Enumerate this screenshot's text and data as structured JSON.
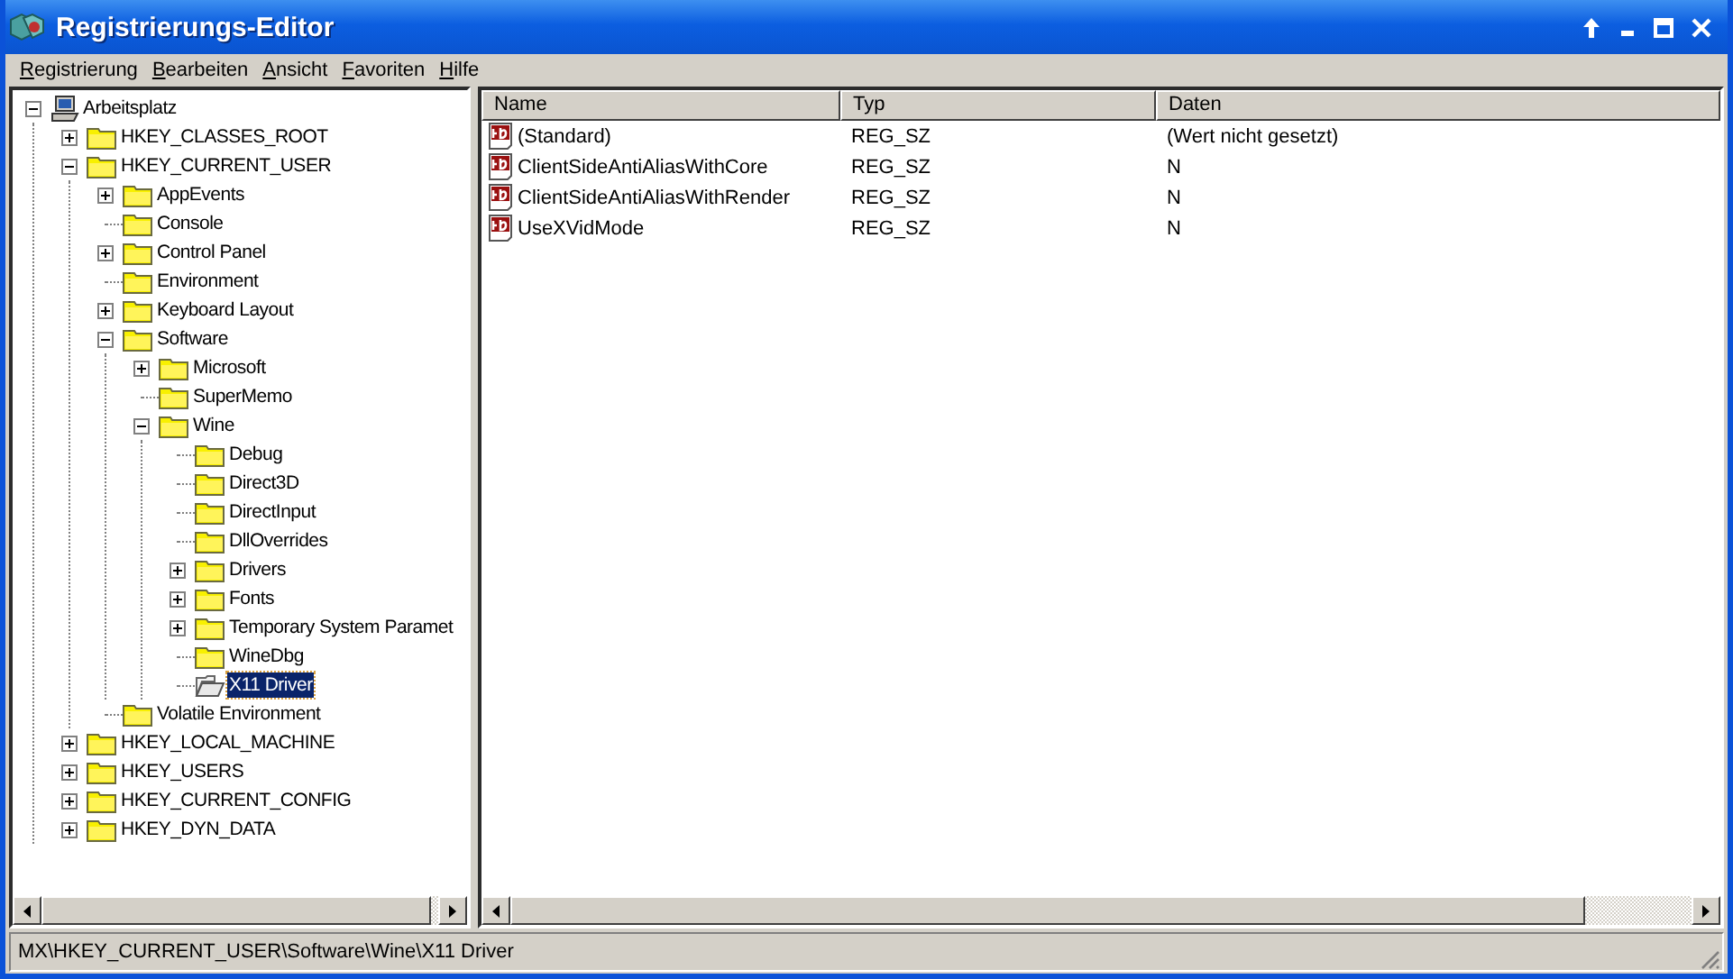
{
  "window": {
    "title": "Registrierungs-Editor"
  },
  "menu": [
    "Registrierung",
    "Bearbeiten",
    "Ansicht",
    "Favoriten",
    "Hilfe"
  ],
  "tree": {
    "label": "Arbeitsplatz",
    "expanded": true,
    "selected": false,
    "children": [
      {
        "label": "HKEY_CLASSES_ROOT",
        "expanded": false,
        "selected": false
      },
      {
        "label": "HKEY_CURRENT_USER",
        "expanded": true,
        "selected": false,
        "children": [
          {
            "label": "AppEvents",
            "expanded": false,
            "selected": false
          },
          {
            "label": "Console",
            "selected": false
          },
          {
            "label": "Control Panel",
            "expanded": false,
            "selected": false
          },
          {
            "label": "Environment",
            "selected": false
          },
          {
            "label": "Keyboard Layout",
            "expanded": false,
            "selected": false
          },
          {
            "label": "Software",
            "expanded": true,
            "selected": false,
            "children": [
              {
                "label": "Microsoft",
                "expanded": false,
                "selected": false
              },
              {
                "label": "SuperMemo",
                "selected": false
              },
              {
                "label": "Wine",
                "expanded": true,
                "selected": false,
                "children": [
                  {
                    "label": "Debug",
                    "selected": false
                  },
                  {
                    "label": "Direct3D",
                    "selected": false
                  },
                  {
                    "label": "DirectInput",
                    "selected": false
                  },
                  {
                    "label": "DllOverrides",
                    "selected": false
                  },
                  {
                    "label": "Drivers",
                    "expanded": false,
                    "selected": false
                  },
                  {
                    "label": "Fonts",
                    "expanded": false,
                    "selected": false
                  },
                  {
                    "label": "Temporary System Paramet",
                    "expanded": false,
                    "selected": false
                  },
                  {
                    "label": "WineDbg",
                    "selected": false
                  },
                  {
                    "label": "X11 Driver",
                    "selected": true
                  }
                ]
              }
            ]
          },
          {
            "label": "Volatile Environment",
            "selected": false
          }
        ]
      },
      {
        "label": "HKEY_LOCAL_MACHINE",
        "expanded": false,
        "selected": false
      },
      {
        "label": "HKEY_USERS",
        "expanded": false,
        "selected": false
      },
      {
        "label": "HKEY_CURRENT_CONFIG",
        "expanded": false,
        "selected": false
      },
      {
        "label": "HKEY_DYN_DATA",
        "expanded": false,
        "selected": false
      }
    ]
  },
  "table": {
    "columns": [
      "Name",
      "Typ",
      "Daten"
    ],
    "rows": [
      {
        "name": "(Standard)",
        "type": "REG_SZ",
        "data": "(Wert nicht gesetzt)"
      },
      {
        "name": "ClientSideAntiAliasWithCore",
        "type": "REG_SZ",
        "data": "N"
      },
      {
        "name": "ClientSideAntiAliasWithRender",
        "type": "REG_SZ",
        "data": "N"
      },
      {
        "name": "UseXVidMode",
        "type": "REG_SZ",
        "data": "N"
      }
    ]
  },
  "status_bar": "MX\\HKEY_CURRENT_USER\\Software\\Wine\\X11 Driver"
}
